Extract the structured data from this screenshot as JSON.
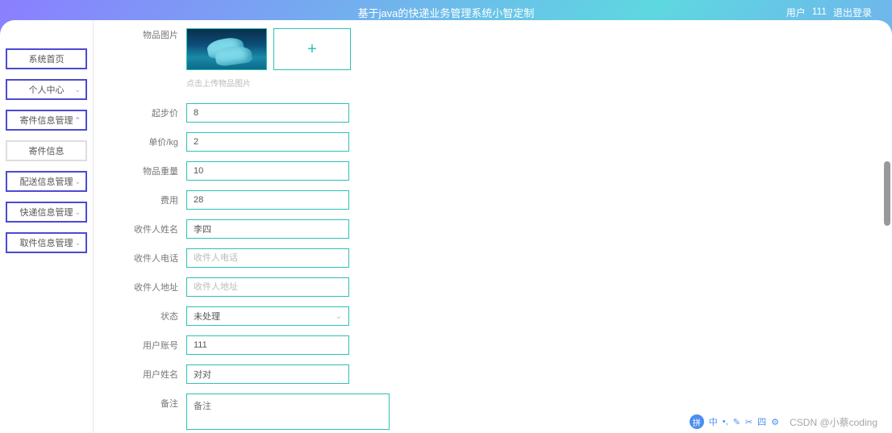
{
  "header": {
    "title": "基于java的快递业务管理系统小智定制",
    "user_prefix": "用户",
    "user_code": "111",
    "logout": "退出登录"
  },
  "sidebar": {
    "items": [
      {
        "label": "系统首页",
        "expandable": false
      },
      {
        "label": "个人中心",
        "expandable": true
      },
      {
        "label": "寄件信息管理",
        "expandable": true,
        "active": true
      },
      {
        "label": "寄件信息",
        "expandable": false,
        "plain": true
      },
      {
        "label": "配送信息管理",
        "expandable": true
      },
      {
        "label": "快递信息管理",
        "expandable": true
      },
      {
        "label": "取件信息管理",
        "expandable": true
      }
    ]
  },
  "form": {
    "image_label": "物品图片",
    "upload_hint": "点击上传物品图片",
    "start_price": {
      "label": "起步价",
      "value": "8"
    },
    "unit_price": {
      "label": "单价/kg",
      "value": "2"
    },
    "weight": {
      "label": "物品重量",
      "value": "10"
    },
    "fee": {
      "label": "费用",
      "value": "28"
    },
    "recv_name": {
      "label": "收件人姓名",
      "value": "李四"
    },
    "recv_phone": {
      "label": "收件人电话",
      "value": "",
      "placeholder": "收件人电话"
    },
    "recv_addr": {
      "label": "收件人地址",
      "value": "",
      "placeholder": "收件人地址"
    },
    "status": {
      "label": "状态",
      "value": "未处理"
    },
    "user_account": {
      "label": "用户账号",
      "value": "111"
    },
    "user_name": {
      "label": "用户姓名",
      "value": "对对"
    },
    "remark": {
      "label": "备注",
      "value": "",
      "placeholder": "备注"
    }
  },
  "watermark": "CSDN @小蔡coding"
}
